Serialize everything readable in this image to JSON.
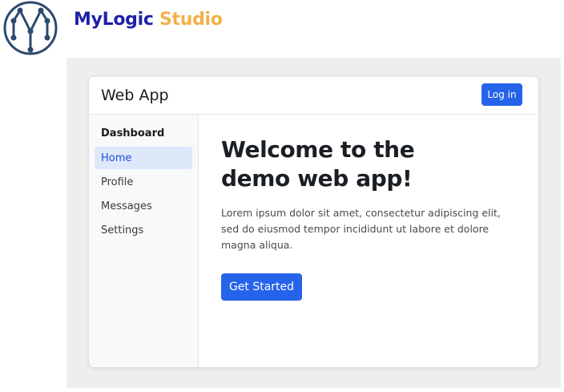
{
  "brand": {
    "logo_icon": "network-m-logo-icon",
    "name_part1": "MyLogic",
    "name_part2": " Studio",
    "colors": {
      "primary": "#1e22a8",
      "accent": "#f4b04a"
    }
  },
  "app": {
    "title": "Web App",
    "login_label": "Log in",
    "accent_color": "#2563eb"
  },
  "sidebar": {
    "heading": "Dashboard",
    "items": [
      {
        "label": "Home",
        "active": true
      },
      {
        "label": "Profile",
        "active": false
      },
      {
        "label": "Messages",
        "active": false
      },
      {
        "label": "Settings",
        "active": false
      }
    ]
  },
  "main": {
    "title": "Welcome to the demo web app!",
    "body": "Lorem ipsum dolor sit amet, consectetur adipiscing elit, sed do eiusmod tempor incididunt ut labore et dolore magna aliqua.",
    "cta_label": "Get Started"
  }
}
